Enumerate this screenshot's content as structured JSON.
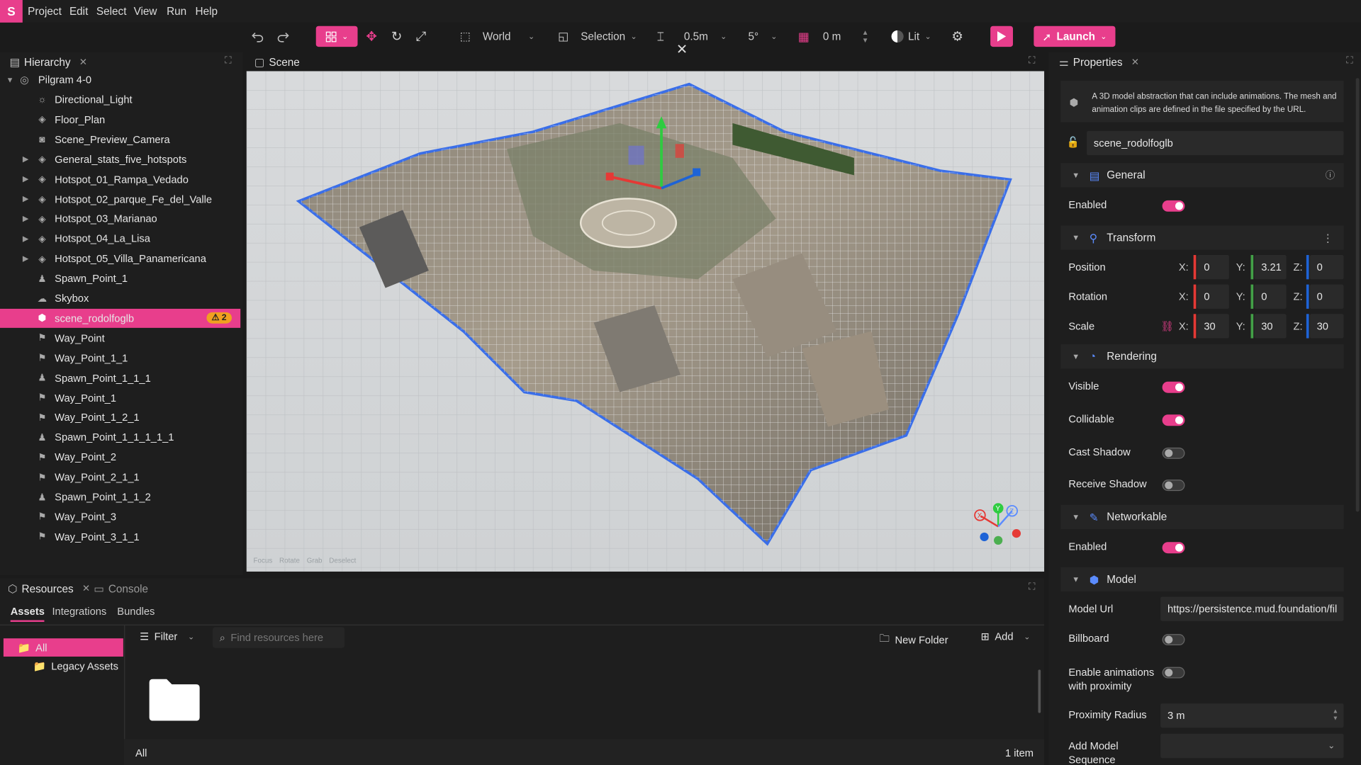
{
  "menu": {
    "logo": "S",
    "items": [
      "Project",
      "Edit",
      "Select",
      "View",
      "Run",
      "Help"
    ]
  },
  "toolbar": {
    "space": "World",
    "selection": "Selection",
    "snap_distance": "0.5m",
    "snap_angle": "5°",
    "grid_offset": "0 m",
    "lighting": "Lit",
    "launch": "Launch"
  },
  "hierarchy": {
    "title": "Hierarchy",
    "root": "Pilgram 4-0",
    "items": [
      {
        "label": "Directional_Light",
        "icon": "light-icon",
        "expandable": false
      },
      {
        "label": "Floor_Plan",
        "icon": "object-icon",
        "expandable": false
      },
      {
        "label": "Scene_Preview_Camera",
        "icon": "camera-icon",
        "expandable": false
      },
      {
        "label": "General_stats_five_hotspots",
        "icon": "object-icon",
        "expandable": true
      },
      {
        "label": "Hotspot_01_Rampa_Vedado",
        "icon": "object-icon",
        "expandable": true
      },
      {
        "label": "Hotspot_02_parque_Fe_del_Valle",
        "icon": "object-icon",
        "expandable": true
      },
      {
        "label": "Hotspot_03_Marianao",
        "icon": "object-icon",
        "expandable": true
      },
      {
        "label": "Hotspot_04_La_Lisa",
        "icon": "object-icon",
        "expandable": true
      },
      {
        "label": "Hotspot_05_Villa_Panamericana",
        "icon": "object-icon",
        "expandable": true
      },
      {
        "label": "Spawn_Point_1",
        "icon": "spawn-icon",
        "expandable": false
      },
      {
        "label": "Skybox",
        "icon": "skybox-icon",
        "expandable": false
      },
      {
        "label": "scene_rodolfoglb",
        "icon": "model-icon",
        "expandable": false,
        "selected": true,
        "warning": "2"
      },
      {
        "label": "Way_Point",
        "icon": "waypoint-icon",
        "expandable": false
      },
      {
        "label": "Way_Point_1_1",
        "icon": "waypoint-icon",
        "expandable": false
      },
      {
        "label": "Spawn_Point_1_1_1",
        "icon": "spawn-icon",
        "expandable": false
      },
      {
        "label": "Way_Point_1",
        "icon": "waypoint-icon",
        "expandable": false
      },
      {
        "label": "Way_Point_1_2_1",
        "icon": "waypoint-icon",
        "expandable": false
      },
      {
        "label": "Spawn_Point_1_1_1_1_1",
        "icon": "spawn-icon",
        "expandable": false
      },
      {
        "label": "Way_Point_2",
        "icon": "waypoint-icon",
        "expandable": false
      },
      {
        "label": "Way_Point_2_1_1",
        "icon": "waypoint-icon",
        "expandable": false
      },
      {
        "label": "Spawn_Point_1_1_2",
        "icon": "spawn-icon",
        "expandable": false
      },
      {
        "label": "Way_Point_3",
        "icon": "waypoint-icon",
        "expandable": false
      },
      {
        "label": "Way_Point_3_1_1",
        "icon": "waypoint-icon",
        "expandable": false
      }
    ]
  },
  "scene": {
    "title": "Scene",
    "hints": [
      "Focus",
      "Rotate",
      "Grab",
      "Deselect"
    ]
  },
  "properties": {
    "title": "Properties",
    "description": "A 3D model abstraction that can include animations. The mesh and animation clips are defined in the file specified by the URL.",
    "name": "scene_rodolfoglb",
    "general": {
      "title": "General",
      "enabled_label": "Enabled",
      "enabled": true
    },
    "transform": {
      "title": "Transform",
      "position_label": "Position",
      "rotation_label": "Rotation",
      "scale_label": "Scale",
      "axis_x": "X:",
      "axis_y": "Y:",
      "axis_z": "Z:",
      "position": {
        "x": "0",
        "y": "3.21",
        "z": "0"
      },
      "rotation": {
        "x": "0",
        "y": "0",
        "z": "0"
      },
      "scale": {
        "x": "30",
        "y": "30",
        "z": "30"
      }
    },
    "rendering": {
      "title": "Rendering",
      "visible_label": "Visible",
      "visible": true,
      "collidable_label": "Collidable",
      "collidable": true,
      "cast_shadow_label": "Cast Shadow",
      "cast_shadow": false,
      "receive_shadow_label": "Receive Shadow",
      "receive_shadow": false
    },
    "networkable": {
      "title": "Networkable",
      "enabled_label": "Enabled",
      "enabled": true
    },
    "model": {
      "title": "Model",
      "url_label": "Model Url",
      "url": "https://persistence.mud.foundation/fil",
      "billboard_label": "Billboard",
      "billboard": false,
      "anim_label_1": "Enable animations",
      "anim_label_2": "with proximity",
      "anim": false,
      "radius_label": "Proximity Radius",
      "radius": "3 m",
      "sequence_label_1": "Add Model",
      "sequence_label_2": "Sequence"
    }
  },
  "resources": {
    "title": "Resources",
    "console": "Console",
    "tabs": [
      "Assets",
      "Integrations",
      "Bundles"
    ],
    "filter": "Filter",
    "search_placeholder": "Find resources here",
    "new_folder": "New Folder",
    "add": "Add",
    "tree": [
      "All",
      "Legacy Assets"
    ],
    "footer_path": "All",
    "footer_count": "1 item"
  },
  "colors": {
    "accent": "#e83e8c",
    "panel": "#1b1b1b",
    "axis_x": "#e53935",
    "axis_y": "#43a047",
    "axis_z": "#1e63d6"
  }
}
